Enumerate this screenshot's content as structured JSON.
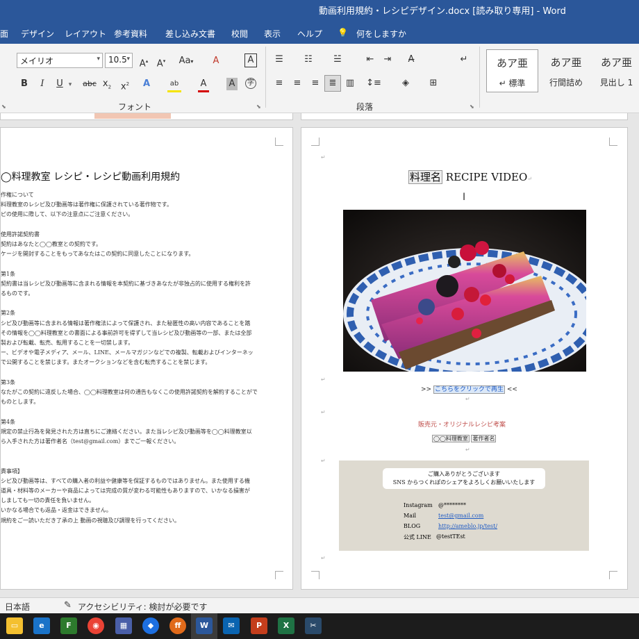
{
  "window": {
    "title": "動画利用規約・レシピデザイン.docx [読み取り専用]  -  Word"
  },
  "menu": [
    "面",
    "デザイン",
    "レイアウト",
    "参考資料",
    "差し込み文書",
    "校閲",
    "表示",
    "ヘルプ",
    "何をしますか"
  ],
  "ribbon": {
    "font_name": "メイリオ",
    "font_size": "10.5",
    "font_group_label": "フォント",
    "paragraph_group_label": "段落",
    "styles": [
      {
        "sample": "あア亜",
        "name": "↵ 標準"
      },
      {
        "sample": "あア亜",
        "name": "行間詰め"
      },
      {
        "sample": "あア亜",
        "name": "見出し 1"
      }
    ]
  },
  "left_page": {
    "heading": "◯料理教室 レシピ・レシピ動画利用規約",
    "lines": [
      "作権について",
      "料理教室のレシピ及び動画等は著作権に保護されている著作物です。",
      "ピの使用に際して、以下の注意点にご注意ください。",
      "",
      "使用許諾契約書",
      "契約はあなたと◯◯教室との契約です。",
      "ケージを開封することをもってあなたはこの契約に同意したことになります。",
      "",
      "第1条",
      "契約書は当レシピ及び動画等に含まれる情報を本契約に基づきあなたが非独占的に使用する権利を許",
      "るものです。",
      "",
      "第2条",
      "シピ及び動画等に含まれる情報は著作権法によって保護され、また秘匿性の高い内容であることを踏",
      "その情報を◯◯料理教室との書面による事前許可を得ずして当レシピ及び動画等の一部、または全部",
      "製および転載、転売、転用することを一切禁します。",
      "ー、ビデオや電子メディア、メール、LINE、メールマガジンなどでの複製、転載およびインターネッ",
      "で公開することを禁じます。またオークションなどを含む転売することを禁じます。",
      "",
      "第3条",
      "なたがこの契約に違反した場合、◯◯料理教室は何の通告もなくこの使用許諾契約を解約することがで",
      "ものとします。",
      "",
      "第4条",
      "規定の禁止行為を発見された方は直ちにご連絡ください。また当レシピ及び動画等を◯◯料理教室以",
      "ら入手された方は著作者名（test@gmail.com）までご一報ください。",
      "",
      "",
      "責事項】",
      "シピ及び動画等は、すべての購入者の利益や健康等を保証するものではありません。また使用する機",
      "道具・材料等のメーカーや商品によっては完成の質が変わる可能性もありますので、いかなる損害が",
      "しましても一切の責任を負いません。",
      "いかなる場合でも返品・返金はできません。",
      "規約をご一読いただき了承の上 動画の視聴及び調理を行ってください。"
    ]
  },
  "right_page": {
    "title_tag": "料理名",
    "title_text": " RECIPE VIDEO",
    "link_prefix": ">> ",
    "link_text": "こちらをクリックで再生",
    "link_suffix": " <<",
    "credit_heading": "販売元・オリジナルレシピ考案",
    "credit_tag1": "◯◯料理教室",
    "credit_tag2": "著作者名",
    "thanks_line1": "ご購入ありがとうございます",
    "thanks_line2": "SNS からつくれぽのシェアをよろしくお願いいたします",
    "contacts": [
      {
        "label": "Instagram",
        "value": "@********"
      },
      {
        "label": "Mail",
        "value": "test@gmail.com"
      },
      {
        "label": "BLOG",
        "value": "http://ameblo.jp/test/"
      },
      {
        "label": "公式 LINE",
        "value": "@testTEst"
      }
    ]
  },
  "status": {
    "language": "日本語",
    "accessibility": "アクセシビリティ: 検討が必要です"
  },
  "colors": {
    "accent": "#2b579a",
    "credit": "#c0504d",
    "link": "#1f5bc4"
  }
}
